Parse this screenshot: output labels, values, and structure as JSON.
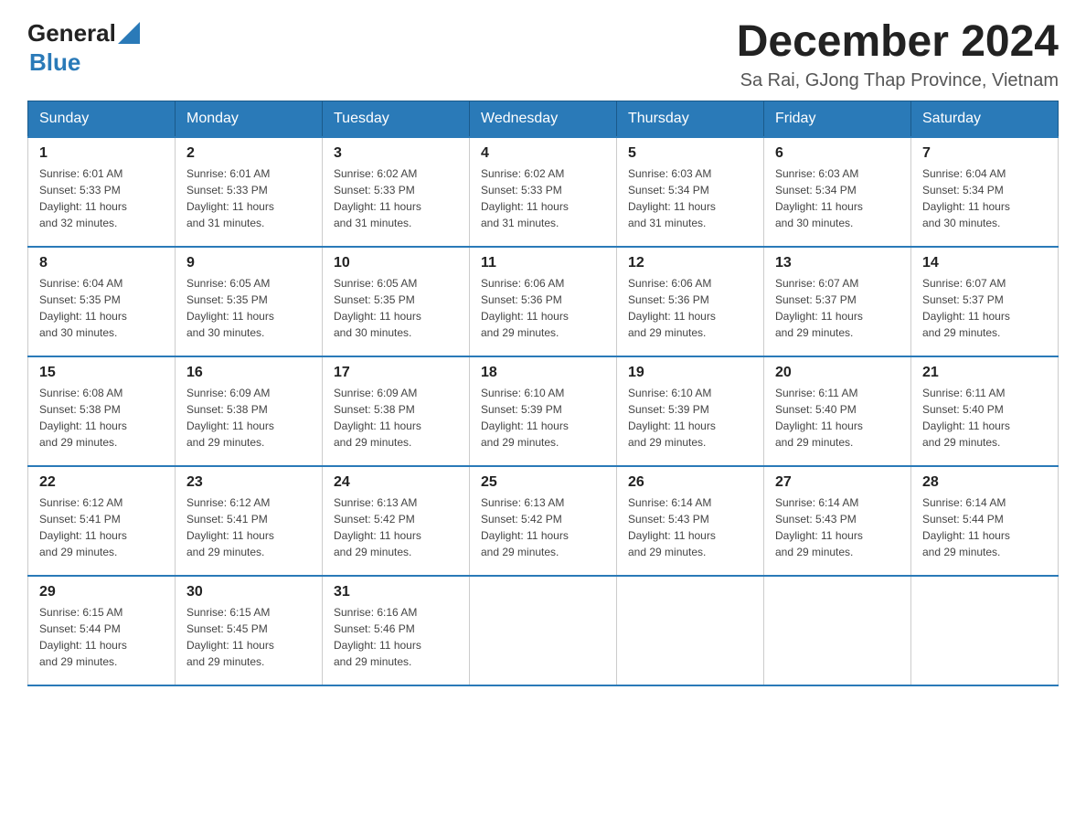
{
  "header": {
    "logo_general": "General",
    "logo_blue": "Blue",
    "month_title": "December 2024",
    "location": "Sa Rai, GJong Thap Province, Vietnam"
  },
  "days_of_week": [
    "Sunday",
    "Monday",
    "Tuesday",
    "Wednesday",
    "Thursday",
    "Friday",
    "Saturday"
  ],
  "weeks": [
    [
      {
        "day": "1",
        "sunrise": "6:01 AM",
        "sunset": "5:33 PM",
        "daylight": "11 hours and 32 minutes."
      },
      {
        "day": "2",
        "sunrise": "6:01 AM",
        "sunset": "5:33 PM",
        "daylight": "11 hours and 31 minutes."
      },
      {
        "day": "3",
        "sunrise": "6:02 AM",
        "sunset": "5:33 PM",
        "daylight": "11 hours and 31 minutes."
      },
      {
        "day": "4",
        "sunrise": "6:02 AM",
        "sunset": "5:33 PM",
        "daylight": "11 hours and 31 minutes."
      },
      {
        "day": "5",
        "sunrise": "6:03 AM",
        "sunset": "5:34 PM",
        "daylight": "11 hours and 31 minutes."
      },
      {
        "day": "6",
        "sunrise": "6:03 AM",
        "sunset": "5:34 PM",
        "daylight": "11 hours and 30 minutes."
      },
      {
        "day": "7",
        "sunrise": "6:04 AM",
        "sunset": "5:34 PM",
        "daylight": "11 hours and 30 minutes."
      }
    ],
    [
      {
        "day": "8",
        "sunrise": "6:04 AM",
        "sunset": "5:35 PM",
        "daylight": "11 hours and 30 minutes."
      },
      {
        "day": "9",
        "sunrise": "6:05 AM",
        "sunset": "5:35 PM",
        "daylight": "11 hours and 30 minutes."
      },
      {
        "day": "10",
        "sunrise": "6:05 AM",
        "sunset": "5:35 PM",
        "daylight": "11 hours and 30 minutes."
      },
      {
        "day": "11",
        "sunrise": "6:06 AM",
        "sunset": "5:36 PM",
        "daylight": "11 hours and 29 minutes."
      },
      {
        "day": "12",
        "sunrise": "6:06 AM",
        "sunset": "5:36 PM",
        "daylight": "11 hours and 29 minutes."
      },
      {
        "day": "13",
        "sunrise": "6:07 AM",
        "sunset": "5:37 PM",
        "daylight": "11 hours and 29 minutes."
      },
      {
        "day": "14",
        "sunrise": "6:07 AM",
        "sunset": "5:37 PM",
        "daylight": "11 hours and 29 minutes."
      }
    ],
    [
      {
        "day": "15",
        "sunrise": "6:08 AM",
        "sunset": "5:38 PM",
        "daylight": "11 hours and 29 minutes."
      },
      {
        "day": "16",
        "sunrise": "6:09 AM",
        "sunset": "5:38 PM",
        "daylight": "11 hours and 29 minutes."
      },
      {
        "day": "17",
        "sunrise": "6:09 AM",
        "sunset": "5:38 PM",
        "daylight": "11 hours and 29 minutes."
      },
      {
        "day": "18",
        "sunrise": "6:10 AM",
        "sunset": "5:39 PM",
        "daylight": "11 hours and 29 minutes."
      },
      {
        "day": "19",
        "sunrise": "6:10 AM",
        "sunset": "5:39 PM",
        "daylight": "11 hours and 29 minutes."
      },
      {
        "day": "20",
        "sunrise": "6:11 AM",
        "sunset": "5:40 PM",
        "daylight": "11 hours and 29 minutes."
      },
      {
        "day": "21",
        "sunrise": "6:11 AM",
        "sunset": "5:40 PM",
        "daylight": "11 hours and 29 minutes."
      }
    ],
    [
      {
        "day": "22",
        "sunrise": "6:12 AM",
        "sunset": "5:41 PM",
        "daylight": "11 hours and 29 minutes."
      },
      {
        "day": "23",
        "sunrise": "6:12 AM",
        "sunset": "5:41 PM",
        "daylight": "11 hours and 29 minutes."
      },
      {
        "day": "24",
        "sunrise": "6:13 AM",
        "sunset": "5:42 PM",
        "daylight": "11 hours and 29 minutes."
      },
      {
        "day": "25",
        "sunrise": "6:13 AM",
        "sunset": "5:42 PM",
        "daylight": "11 hours and 29 minutes."
      },
      {
        "day": "26",
        "sunrise": "6:14 AM",
        "sunset": "5:43 PM",
        "daylight": "11 hours and 29 minutes."
      },
      {
        "day": "27",
        "sunrise": "6:14 AM",
        "sunset": "5:43 PM",
        "daylight": "11 hours and 29 minutes."
      },
      {
        "day": "28",
        "sunrise": "6:14 AM",
        "sunset": "5:44 PM",
        "daylight": "11 hours and 29 minutes."
      }
    ],
    [
      {
        "day": "29",
        "sunrise": "6:15 AM",
        "sunset": "5:44 PM",
        "daylight": "11 hours and 29 minutes."
      },
      {
        "day": "30",
        "sunrise": "6:15 AM",
        "sunset": "5:45 PM",
        "daylight": "11 hours and 29 minutes."
      },
      {
        "day": "31",
        "sunrise": "6:16 AM",
        "sunset": "5:46 PM",
        "daylight": "11 hours and 29 minutes."
      },
      null,
      null,
      null,
      null
    ]
  ],
  "labels": {
    "sunrise": "Sunrise:",
    "sunset": "Sunset:",
    "daylight": "Daylight:"
  }
}
